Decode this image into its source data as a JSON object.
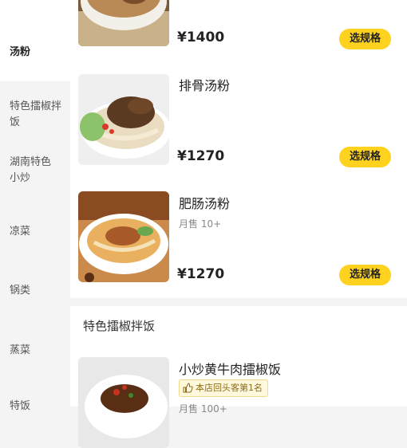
{
  "sidebar": {
    "items": [
      {
        "label": "汤粉",
        "active": true
      },
      {
        "label": "特色擂椒拌饭",
        "active": false
      },
      {
        "label": "湖南特色小炒",
        "active": false
      },
      {
        "label": "凉菜",
        "active": false
      },
      {
        "label": "锅类",
        "active": false
      },
      {
        "label": "蒸菜",
        "active": false
      },
      {
        "label": "特饭",
        "active": false
      }
    ]
  },
  "menu": {
    "items": [
      {
        "name": "",
        "price": "¥1400",
        "button": "选规格",
        "image_icon": "noodle-soup-icon"
      },
      {
        "name": "排骨汤粉",
        "price": "¥1270",
        "button": "选规格",
        "image_icon": "noodle-soup-icon"
      },
      {
        "name": "肥肠汤粉",
        "monthly": "月售 10+",
        "price": "¥1270",
        "button": "选规格",
        "image_icon": "noodle-soup-icon"
      }
    ],
    "section2": {
      "title": "特色擂椒拌饭",
      "items": [
        {
          "name": "小炒黄牛肉擂椒饭",
          "rank": "本店回头客第1名",
          "monthly": "月售 100+",
          "image_icon": "rice-dish-icon"
        }
      ]
    }
  },
  "colors": {
    "accent": "#ffd21f",
    "background": "#f4f4f4"
  }
}
